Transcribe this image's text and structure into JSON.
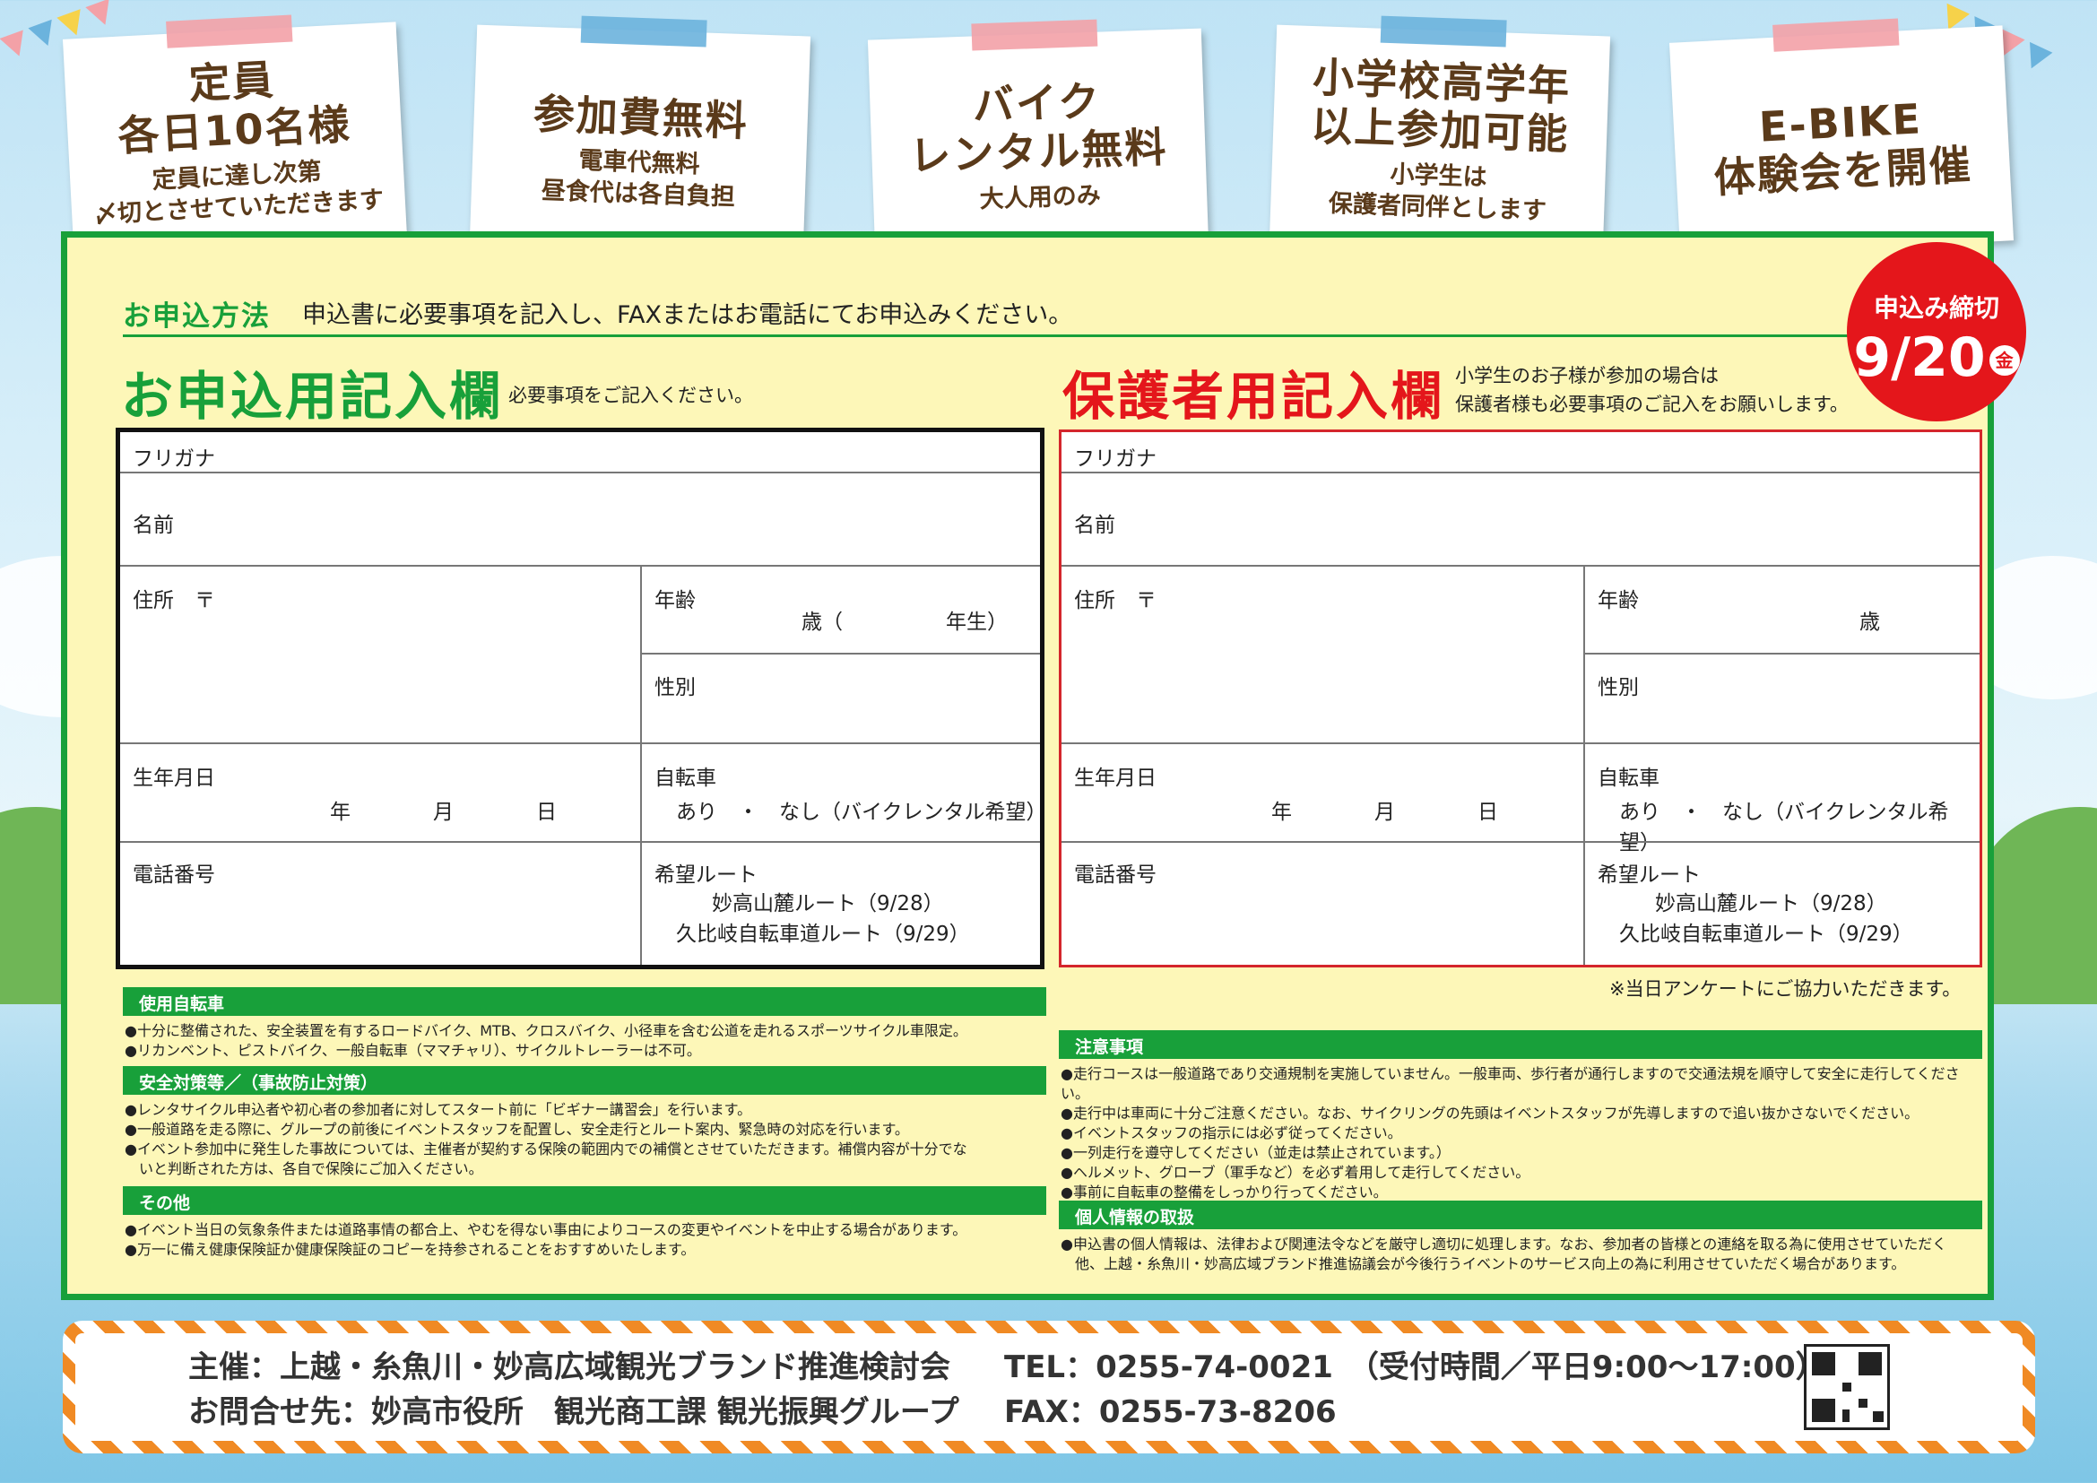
{
  "cards": [
    {
      "big": [
        "定員",
        "各日10名様"
      ],
      "small": [
        "定員に達し次第",
        "〆切とさせていただきます"
      ],
      "tape": "#f3a1a7"
    },
    {
      "big": [
        "参加費無料"
      ],
      "small": [
        "電車代無料",
        "昼食代は各自負担"
      ],
      "tape": "#6bb3dd"
    },
    {
      "big": [
        "バイク",
        "レンタル無料"
      ],
      "small": [
        "大人用のみ"
      ],
      "tape": "#f3a1a7"
    },
    {
      "big": [
        "小学校高学年",
        "以上参加可能"
      ],
      "small": [
        "小学生は",
        "保護者同伴とします"
      ],
      "tape": "#6bb3dd"
    },
    {
      "big": [
        "E-BIKE",
        "体験会を開催"
      ],
      "small": [],
      "tape": "#f3a1a7"
    }
  ],
  "howto": {
    "label": "お申込方法",
    "text": "申込書に必要事項を記入し、FAXまたはお電話にてお申込みください。"
  },
  "deadline": {
    "label": "申込み締切",
    "date": "9/20",
    "day": "金"
  },
  "applicant": {
    "title": "お申込用記入欄",
    "note": "必要事項をご記入ください。",
    "furigana": "フリガナ",
    "name": "名前",
    "address": "住所　〒",
    "age": "年齢",
    "age_unit": "歳（　　　　　年生）",
    "gender": "性別",
    "birthday": "生年月日",
    "birthday_units": "年　　　　月　　　　日",
    "bicycle": "自転車",
    "bicycle_options": "あり　・　なし（バイクレンタル希望）",
    "phone": "電話番号",
    "route": "希望ルート",
    "route_1": "妙高山麓ルート（9/28）",
    "route_2": "久比岐自転車道ルート（9/29）"
  },
  "guardian": {
    "title": "保護者用記入欄",
    "note_1": "小学生のお子様が参加の場合は",
    "note_2": "保護者様も必要事項のご記入をお願いします。",
    "furigana": "フリガナ",
    "name": "名前",
    "address": "住所　〒",
    "age": "年齢",
    "age_unit": "歳",
    "gender": "性別",
    "birthday": "生年月日",
    "birthday_units": "年　　　　月　　　　日",
    "bicycle": "自転車",
    "bicycle_options": "あり　・　なし（バイクレンタル希望）",
    "phone": "電話番号",
    "route": "希望ルート",
    "route_1": "妙高山麓ルート（9/28）",
    "route_2": "久比岐自転車道ルート（9/29）"
  },
  "survey": "※当日アンケートにご協力いただきます。",
  "notes_left": [
    {
      "title": "使用自転車",
      "lines": [
        "●十分に整備された、安全装置を有するロードバイク、MTB、クロスバイク、小径車を含む公道を走れるスポーツサイクル車限定。",
        "●リカンベント、ピストバイク、一般自転車（ママチャリ）、サイクルトレーラーは不可。"
      ]
    },
    {
      "title": "安全対策等／（事故防止対策）",
      "lines": [
        "●レンタサイクル申込者や初心者の参加者に対してスタート前に「ビギナー講習会」を行います。",
        "●一般道路を走る際に、グループの前後にイベントスタッフを配置し、安全走行とルート案内、緊急時の対応を行います。",
        "●イベント参加中に発生した事故については、主催者が契約する保険の範囲内での補償とさせていただきます。補償内容が十分でな",
        "　いと判断された方は、各自で保険にご加入ください。"
      ]
    },
    {
      "title": "その他",
      "lines": [
        "●イベント当日の気象条件または道路事情の都合上、やむを得ない事由によりコースの変更やイベントを中止する場合があります。",
        "●万一に備え健康保険証か健康保険証のコピーを持参されることをおすすめいたします。"
      ]
    }
  ],
  "notes_right": [
    {
      "title": "注意事項",
      "lines": [
        "●走行コースは一般道路であり交通規制を実施していません。一般車両、歩行者が通行しますので交通法規を順守して安全に走行してください。",
        "●走行中は車両に十分ご注意ください。なお、サイクリングの先頭はイベントスタッフが先導しますので追い抜かさないでください。",
        "●イベントスタッフの指示には必ず従ってください。",
        "●一列走行を遵守してください（並走は禁止されています。）",
        "●ヘルメット、グローブ（軍手など）を必ず着用して走行してください。",
        "●事前に自転車の整備をしっかり行ってください。"
      ]
    },
    {
      "title": "個人情報の取扱",
      "lines": [
        "●申込書の個人情報は、法律および関連法令などを厳守し適切に処理します。なお、参加者の皆様との連絡を取る為に使用させていただく",
        "　他、上越・糸魚川・妙高広域ブランド推進協議会が今後行うイベントのサービス向上の為に利用させていただく場合があります。"
      ]
    }
  ],
  "footer": {
    "organizer": "主催：上越・糸魚川・妙高広域観光ブランド推進検討会",
    "contact": "お問合せ先：妙高市役所　観光商工課 観光振興グループ",
    "tel": "TEL：0255-74-0021　（受付時間／平日9:00～17:00）",
    "fax": "FAX：0255-73-8206"
  },
  "colors": {
    "green": "#18a03a",
    "red": "#e4161b",
    "brown": "#5a3a1a"
  }
}
